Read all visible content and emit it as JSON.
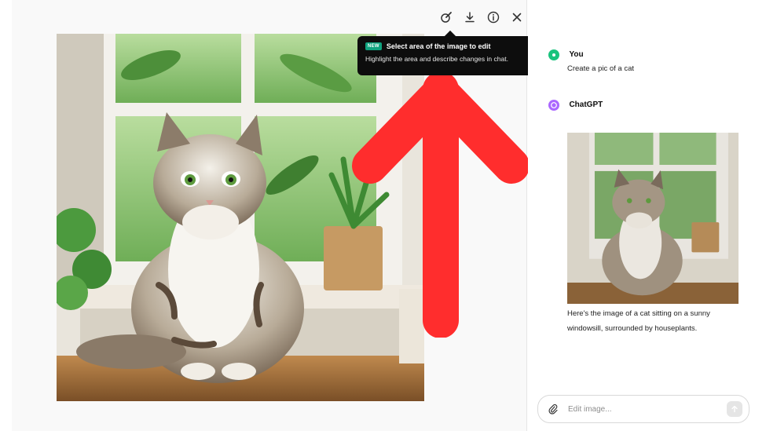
{
  "viewer": {
    "toolbar": {
      "select_icon": "select-area-brush-icon",
      "download_icon": "download-icon",
      "info_icon": "info-icon",
      "close_icon": "close-icon"
    },
    "image_alt": "cat on a sunny windowsill with houseplants"
  },
  "tooltip": {
    "badge": "NEW",
    "title": "Select area of the image to edit",
    "body": "Highlight the area and describe changes in chat."
  },
  "chat": {
    "messages": [
      {
        "sender": "You",
        "text": "Create a pic of a cat"
      },
      {
        "sender": "ChatGPT",
        "text": ""
      }
    ],
    "caption_line1": "Here's the image of a cat sitting on a sunny",
    "caption_line2": "windowsill, surrounded by houseplants."
  },
  "composer": {
    "placeholder": "Edit image..."
  },
  "colors": {
    "annotation_arrow": "#ff2d2d",
    "user_avatar": "#19c37d",
    "assistant_avatar": "#ab68ff",
    "badge": "#10a37f"
  }
}
